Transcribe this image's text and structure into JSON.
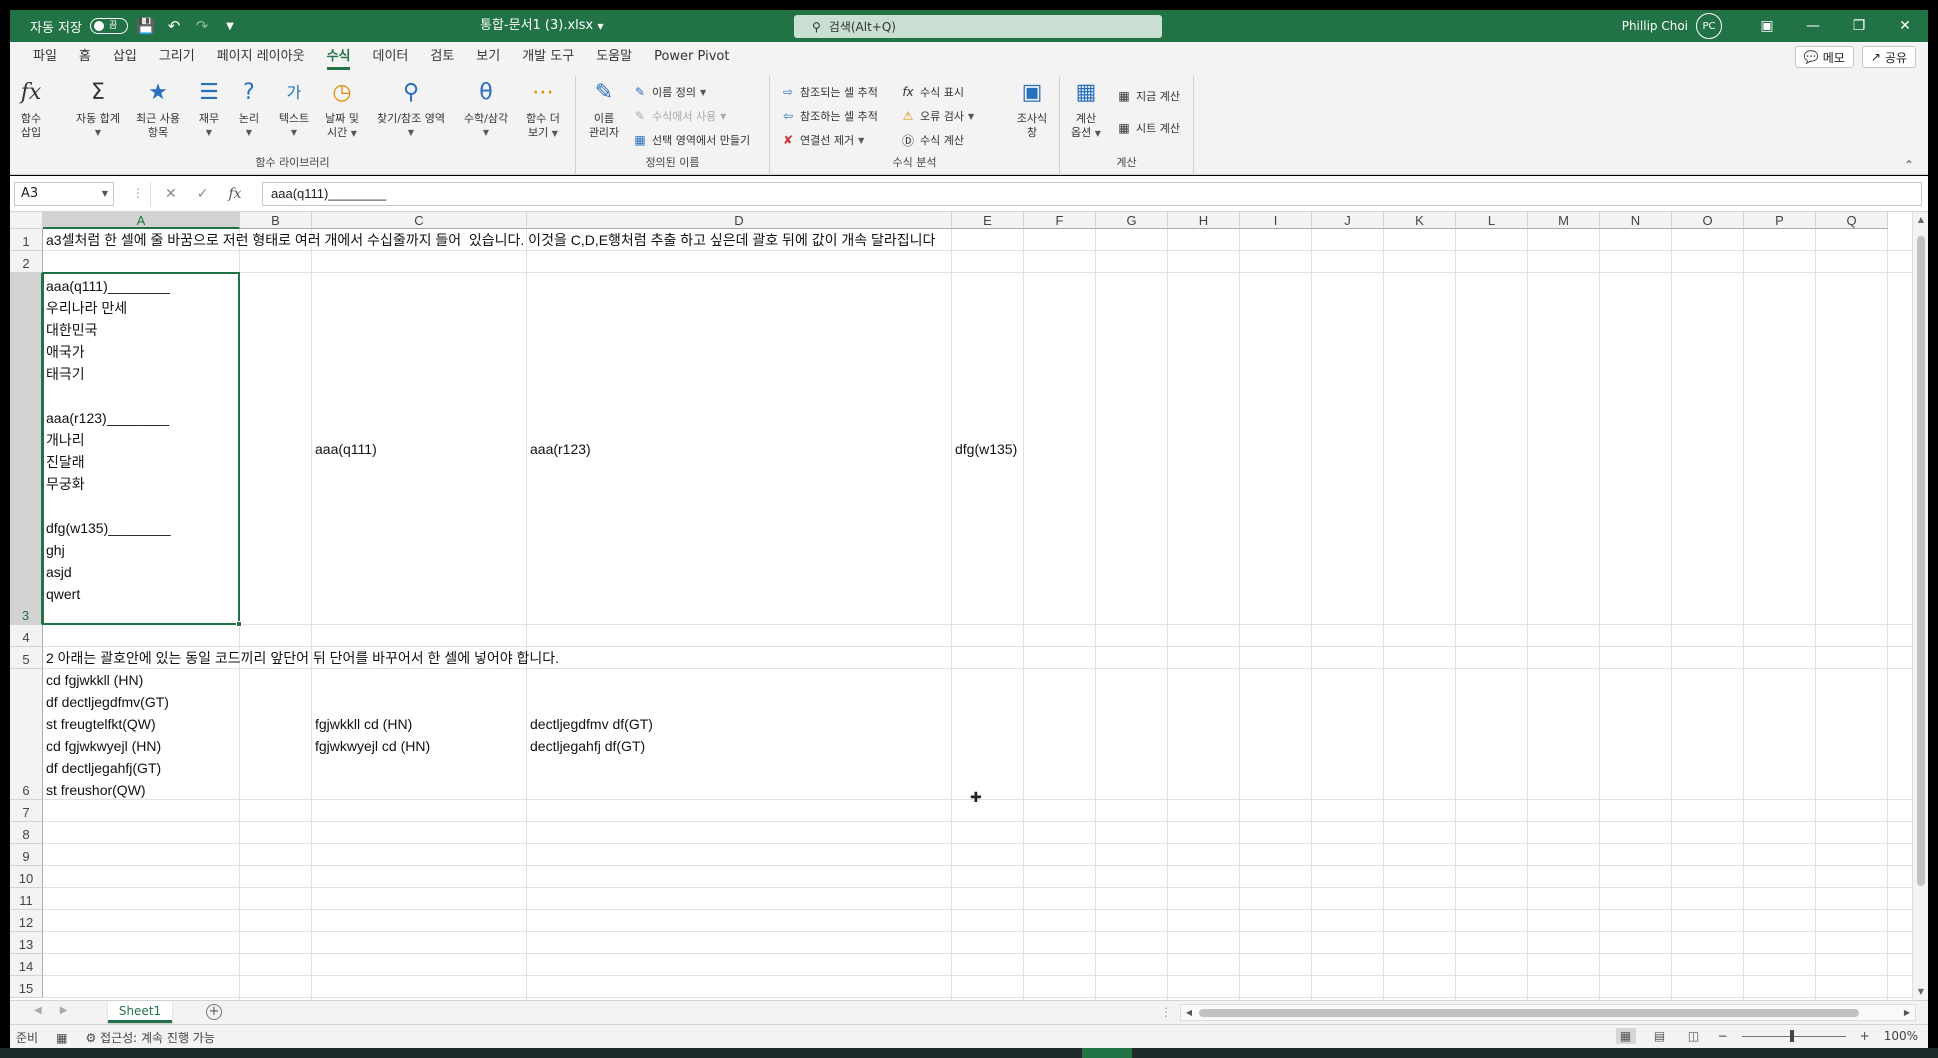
{
  "titlebar": {
    "autosave_label": "자동 저장",
    "autosave_state": "끔",
    "doc_title": "통합-문서1 (3).xlsx",
    "search_placeholder": "검색(Alt+Q)",
    "user_name": "Phillip Choi",
    "user_initials": "PC"
  },
  "tabs": [
    {
      "label": "파일"
    },
    {
      "label": "홈"
    },
    {
      "label": "삽입"
    },
    {
      "label": "그리기"
    },
    {
      "label": "페이지 레이아웃"
    },
    {
      "label": "수식",
      "active": true
    },
    {
      "label": "데이터"
    },
    {
      "label": "검토"
    },
    {
      "label": "보기"
    },
    {
      "label": "개발 도구"
    },
    {
      "label": "도움말"
    },
    {
      "label": "Power Pivot"
    }
  ],
  "tab_buttons": {
    "memo": "메모",
    "share": "공유"
  },
  "ribbon": {
    "groups": {
      "function_library": "함수 라이브러리",
      "defined_names": "정의된 이름",
      "formula_auditing": "수식 분석",
      "calculation": "계산"
    },
    "insert_function": {
      "line1": "함수",
      "line2": "삽입"
    },
    "autosum": "자동 합계",
    "recent": {
      "line1": "최근 사용",
      "line2": "항목"
    },
    "financial": "재무",
    "logical": "논리",
    "text": "텍스트",
    "datetime": {
      "line1": "날짜 및",
      "line2": "시간"
    },
    "lookup": "찾기/참조 영역",
    "math": "수학/삼각",
    "more": {
      "line1": "함수 더",
      "line2": "보기"
    },
    "name_manager": {
      "line1": "이름",
      "line2": "관리자"
    },
    "define_name": "이름 정의",
    "use_in_formula": "수식에서 사용",
    "create_from_selection": "선택 영역에서 만들기",
    "trace_precedents": "참조되는 셀 추적",
    "trace_dependents": "참조하는 셀 추적",
    "remove_arrows": "연결선 제거",
    "show_formulas": "수식 표시",
    "error_checking": "오류 검사",
    "evaluate_formula": "수식 계산",
    "watch_window": {
      "line1": "조사식",
      "line2": "창"
    },
    "calc_options": {
      "line1": "계산",
      "line2": "옵션"
    },
    "calc_now": "지금 계산",
    "calc_sheet": "시트 계산"
  },
  "formula_bar": {
    "name_box": "A3",
    "formula": "aaa(q111)________"
  },
  "columns": [
    "A",
    "B",
    "C",
    "D",
    "E",
    "F",
    "G",
    "H",
    "I",
    "J",
    "K",
    "L",
    "M",
    "N",
    "O",
    "P",
    "Q"
  ],
  "rows": [
    "1",
    "2",
    "3",
    "4",
    "5",
    "6",
    "7",
    "8",
    "9",
    "10",
    "11",
    "12",
    "13",
    "14",
    "15"
  ],
  "cells": {
    "A1": "a3셀처럼 한 셀에 줄 바꿈으로 저런 형태로 여러 개에서 수십줄까지 들어  있습니다. 이것을 C,D,E행처럼 추출 하고 싶은데 괄호 뒤에 값이 개속 달라집니다",
    "A3": "aaa(q111)________\n우리나라 만세\n대한민국\n애국가\n태극기\n\naaa(r123)________\n개나리\n진달래\n무궁화\n\ndfg(w135)________\nghj\nasjd\nqwert",
    "C3": "aaa(q111)",
    "D3": "aaa(r123)",
    "E3": "dfg(w135)",
    "A5": "2 아래는 괄호안에 있는 동일 코드끼리 앞단어 뒤 단어를 바꾸어서 한 셀에 넣어야 합니다.",
    "A6": "cd fgjwkkll (HN)\ndf dectljegdfmv(GT)\nst freugtelfkt(QW)\ncd fgjwkwyejl (HN)\ndf dectljegahfj(GT)\nst freushor(QW)",
    "C6": "fgjwkkll cd (HN)\nfgjwkwyejl cd (HN)",
    "D6": "dectljegdfmv df(GT)\ndectljegahfj df(GT)"
  },
  "sheet_tab": "Sheet1",
  "status": {
    "ready": "준비",
    "accessibility": "접근성: 계속 진행 가능",
    "zoom": "100%"
  },
  "colors": {
    "accent": "#217346"
  }
}
